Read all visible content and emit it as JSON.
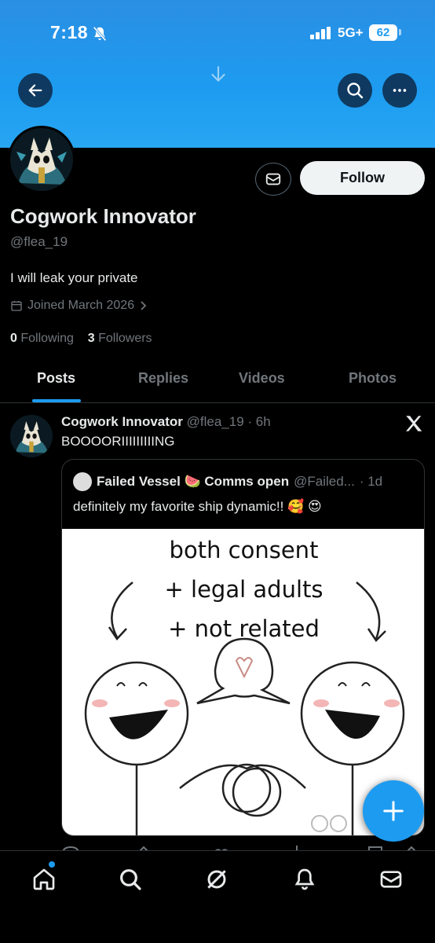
{
  "status_bar": {
    "time": "7:18",
    "network": "5G+",
    "battery": "62"
  },
  "profile": {
    "name": "Cogwork Innovator",
    "handle": "@flea_19",
    "bio": "I will leak your private",
    "joined": "Joined March 2026",
    "following_count": "0",
    "following_label": "Following",
    "followers_count": "3",
    "followers_label": "Followers",
    "follow_label": "Follow"
  },
  "tabs": [
    {
      "label": "Posts",
      "active": true
    },
    {
      "label": "Replies"
    },
    {
      "label": "Videos"
    },
    {
      "label": "Photos"
    }
  ],
  "post": {
    "author": "Cogwork Innovator",
    "handle": "@flea_19",
    "time": "· 6h",
    "text": "BOOOORIIIIIIIIING",
    "quote": {
      "author": "Failed Vessel 🍉 Comms open",
      "handle": "@Failed...",
      "time": "· 1d",
      "text": "definitely my favorite ship dynamic!! 🥰 😍",
      "image_lines": [
        "both consent",
        "+ legal adults",
        "+ not related"
      ],
      "watermark": "tiktok-logo"
    }
  },
  "icons": {
    "back": "arrow-left-icon",
    "search": "search-icon",
    "more": "more-horizontal-icon",
    "mail": "mail-icon",
    "calendar": "calendar-icon",
    "x_logo": "x-logo-icon",
    "compose": "plus-icon"
  },
  "bottom_nav": [
    "home-icon",
    "search-icon",
    "grok-icon",
    "notifications-icon",
    "messages-icon"
  ],
  "colors": {
    "accent": "#1d9bf0",
    "background": "#000000",
    "text": "#e7e9ea",
    "muted": "#71767b"
  }
}
